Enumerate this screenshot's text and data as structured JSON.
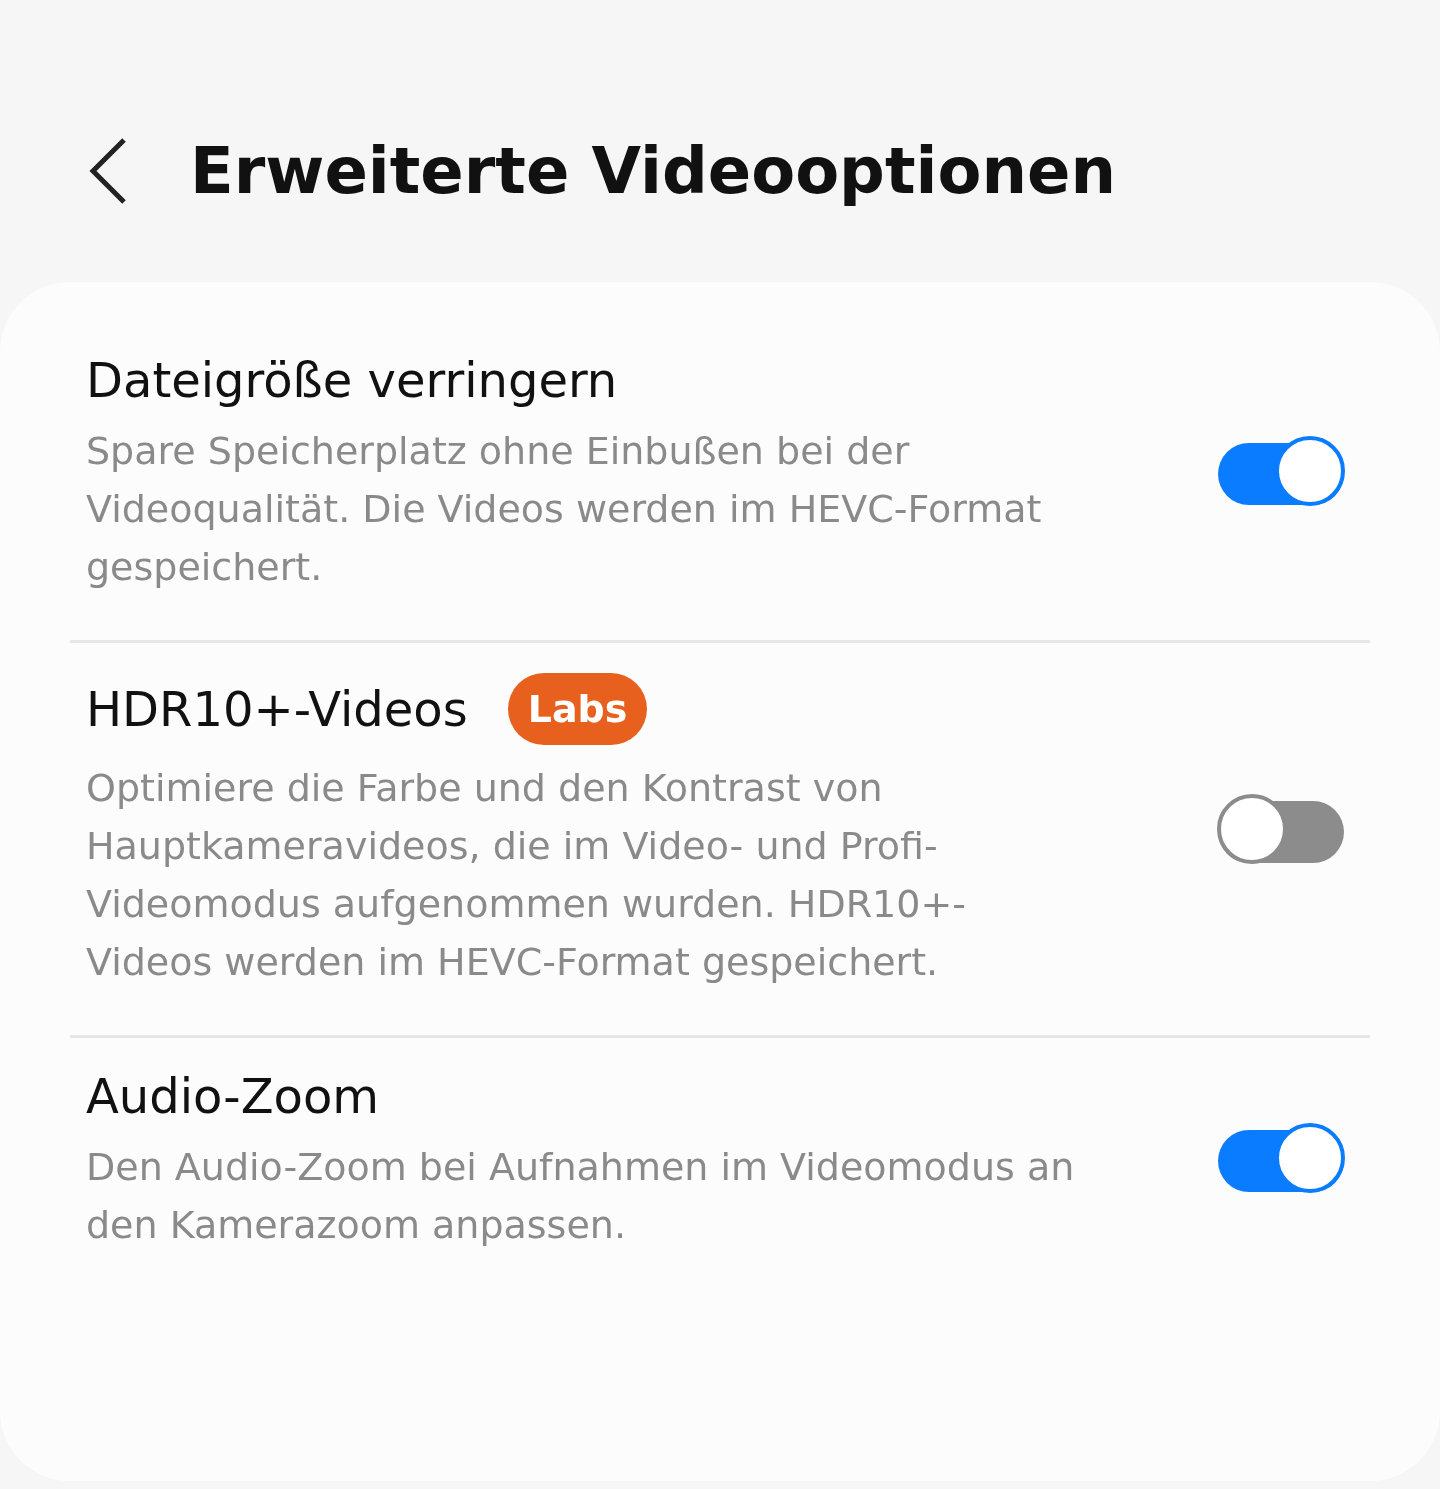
{
  "header": {
    "title": "Erweiterte Videooptionen"
  },
  "settings": [
    {
      "title": "Dateigröße verringern",
      "description": "Spare Speicherplatz ohne Einbußen bei der Videoqualität. Die Videos werden im HEVC-Format gespeichert.",
      "on": true
    },
    {
      "title": "HDR10+-Videos",
      "badge": "Labs",
      "description": "Optimiere die Farbe und den Kontrast von Hauptkameravideos, die im Video- und Profi-Videomodus aufgenommen wurden. HDR10+-Videos werden im HEVC-Format gespeichert.",
      "on": false
    },
    {
      "title": "Audio-Zoom",
      "description": "Den Audio-Zoom bei Aufnahmen im Videomodus an den Kamerazoom anpassen.",
      "on": true
    }
  ]
}
